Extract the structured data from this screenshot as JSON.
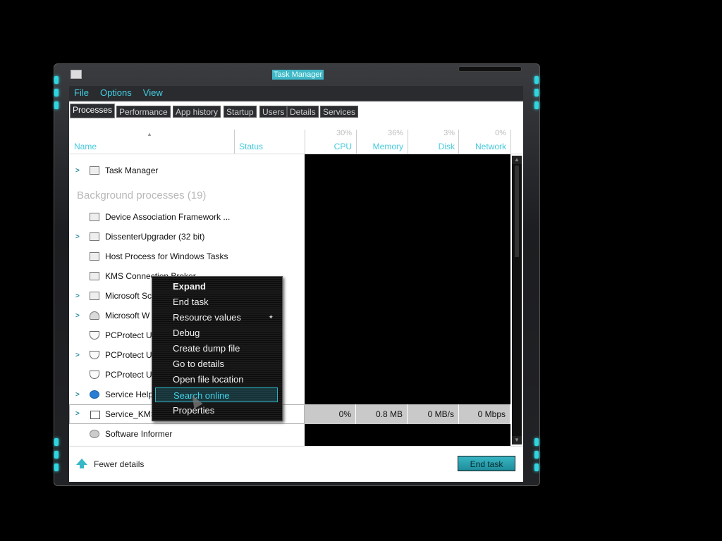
{
  "window": {
    "title": "Task Manager"
  },
  "menu": {
    "items": [
      "File",
      "Options",
      "View"
    ]
  },
  "tabs": [
    "Processes",
    "Performance",
    "App history",
    "Startup",
    "Users",
    "Details",
    "Services"
  ],
  "columns": {
    "name": "Name",
    "status": "Status",
    "cpu": {
      "label": "CPU",
      "pct": "30%"
    },
    "memory": {
      "label": "Memory",
      "pct": "36%"
    },
    "disk": {
      "label": "Disk",
      "pct": "3%"
    },
    "network": {
      "label": "Network",
      "pct": "0%"
    }
  },
  "apps": [
    {
      "name": "Task Manager",
      "expandable": true,
      "icon": "task-manager-icon"
    }
  ],
  "background": {
    "label": "Background processes (19)",
    "rows": [
      {
        "name": "Device Association Framework ...",
        "expandable": false,
        "icon": "window-icon"
      },
      {
        "name": "DissenterUpgrader (32 bit)",
        "expandable": true,
        "icon": "window-icon"
      },
      {
        "name": "Host Process for Windows Tasks",
        "expandable": false,
        "icon": "window-icon"
      },
      {
        "name": "KMS Connection Broker",
        "expandable": false,
        "icon": "window-icon"
      },
      {
        "name": "Microsoft Sc",
        "expandable": true,
        "icon": "window-icon"
      },
      {
        "name": "Microsoft W",
        "expandable": true,
        "icon": "user-icon"
      },
      {
        "name": "PCProtect U",
        "expandable": false,
        "icon": "shield-icon"
      },
      {
        "name": "PCProtect U",
        "expandable": true,
        "icon": "shield-icon"
      },
      {
        "name": "PCProtect U",
        "expandable": false,
        "icon": "shield-icon"
      },
      {
        "name": "Service Help",
        "expandable": true,
        "icon": "blue-gear-icon"
      }
    ]
  },
  "selected_row": {
    "name": "Service_KMS",
    "cpu": "0%",
    "memory": "0.8 MB",
    "disk": "0 MB/s",
    "network": "0 Mbps"
  },
  "last_row": {
    "name": "Software Informer",
    "icon": "circle-icon"
  },
  "footer": {
    "fewer_details": "Fewer details",
    "end_task": "End task"
  },
  "context_menu": {
    "items": [
      {
        "label": "Expand",
        "bold": true
      },
      {
        "label": "End task"
      },
      {
        "label": "Resource values",
        "submenu": true
      },
      {
        "label": "Debug"
      },
      {
        "label": "Create dump file"
      },
      {
        "label": "Go to details"
      },
      {
        "label": "Open file location"
      },
      {
        "label": "Search online",
        "hover": true
      },
      {
        "label": "Properties"
      }
    ]
  },
  "colors": {
    "accent": "#42d0e6",
    "glow": "#2fd6e0",
    "end_task_button": "#2aa3b2"
  }
}
